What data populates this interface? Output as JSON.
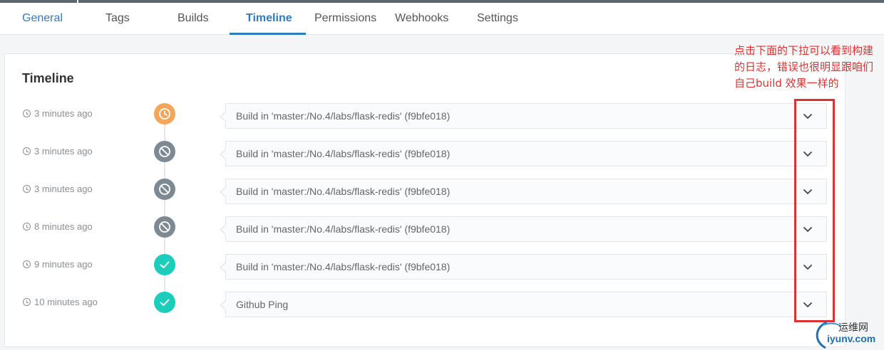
{
  "tabs": [
    {
      "label": "General"
    },
    {
      "label": "Tags"
    },
    {
      "label": "Builds"
    },
    {
      "label": "Timeline"
    },
    {
      "label": "Permissions"
    },
    {
      "label": "Webhooks"
    },
    {
      "label": "Settings"
    }
  ],
  "active_tab": "Timeline",
  "panel": {
    "title": "Timeline"
  },
  "timeline": [
    {
      "time": "3 minutes ago",
      "status": "pending",
      "label": "Build in 'master:/No.4/labs/flask-redis' (f9bfe018)"
    },
    {
      "time": "3 minutes ago",
      "status": "cancelled",
      "label": "Build in 'master:/No.4/labs/flask-redis' (f9bfe018)"
    },
    {
      "time": "3 minutes ago",
      "status": "cancelled",
      "label": "Build in 'master:/No.4/labs/flask-redis' (f9bfe018)"
    },
    {
      "time": "8 minutes ago",
      "status": "cancelled",
      "label": "Build in 'master:/No.4/labs/flask-redis' (f9bfe018)"
    },
    {
      "time": "9 minutes ago",
      "status": "success",
      "label": "Build in 'master:/No.4/labs/flask-redis' (f9bfe018)"
    },
    {
      "time": "10 minutes ago",
      "status": "success",
      "label": "Github Ping"
    }
  ],
  "annotation": {
    "text": "点击下面的下拉可以看到构建的日志，错误也很明显跟咱们自己build 效果一样的"
  },
  "watermark": {
    "line1": "运维网",
    "line2": "iyunv.com"
  },
  "colors": {
    "accent": "#2f7bbf",
    "pending": "#f5a55a",
    "cancelled": "#7e8a93",
    "success": "#1ccdbb",
    "annotation": "#e03030"
  }
}
